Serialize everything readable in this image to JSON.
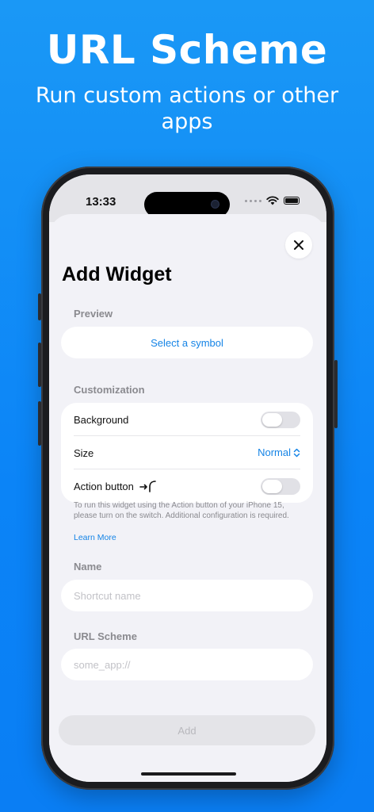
{
  "promo": {
    "title": "URL Scheme",
    "subtitle": "Run custom actions or other apps"
  },
  "status_bar": {
    "time": "13:33"
  },
  "sheet": {
    "title": "Add Widget",
    "preview": {
      "label": "Preview",
      "symbol_link": "Select a symbol"
    },
    "customization": {
      "label": "Customization",
      "background_label": "Background",
      "background_on": false,
      "size_label": "Size",
      "size_value": "Normal",
      "action_button_label": "Action button",
      "action_button_on": false
    },
    "note": "To run this widget using the Action button of your iPhone 15, please turn on the switch. Additional configuration is required.",
    "learn_more": "Learn More",
    "name": {
      "label": "Name",
      "placeholder": "Shortcut name"
    },
    "url_scheme": {
      "label": "URL Scheme",
      "placeholder": "some_app://"
    },
    "add_button": "Add"
  },
  "colors": {
    "background": "#0b84f7",
    "accent": "#1584e6",
    "sheet": "#f2f2f7"
  }
}
